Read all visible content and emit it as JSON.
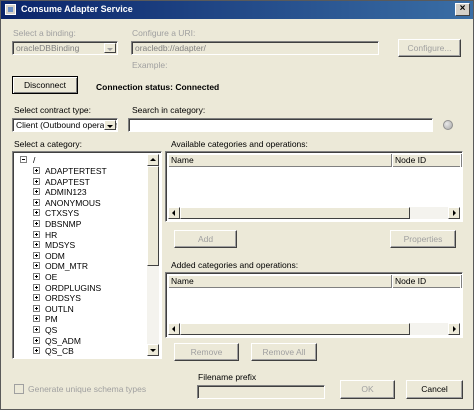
{
  "window": {
    "title": "Consume Adapter Service"
  },
  "binding": {
    "label": "Select a binding:",
    "value": "oracleDBBinding"
  },
  "uri": {
    "label": "Configure a URI:",
    "value": "oracledb://adapter/",
    "example_label": "Example:",
    "configure_button": "Configure..."
  },
  "connection": {
    "disconnect_button": "Disconnect",
    "status": "Connection status: Connected"
  },
  "contract": {
    "label": "Select contract type:",
    "value": "Client (Outbound operations)"
  },
  "search": {
    "label": "Search in category:",
    "value": ""
  },
  "category": {
    "label": "Select a category:",
    "root": "/",
    "items": [
      "ADAPTERTEST",
      "ADAPTEST",
      "ADMIN123",
      "ANONYMOUS",
      "CTXSYS",
      "DBSNMP",
      "HR",
      "MDSYS",
      "ODM",
      "ODM_MTR",
      "OE",
      "ORDPLUGINS",
      "ORDSYS",
      "OUTLN",
      "PM",
      "QS",
      "QS_ADM",
      "QS_CB"
    ]
  },
  "available": {
    "label": "Available categories and operations:",
    "columns": [
      "Name",
      "Node ID"
    ],
    "rows": []
  },
  "actions": {
    "add_button": "Add",
    "properties_button": "Properties",
    "remove_button": "Remove",
    "remove_all_button": "Remove All"
  },
  "added": {
    "label": "Added categories and operations:",
    "columns": [
      "Name",
      "Node ID"
    ],
    "rows": []
  },
  "footer": {
    "generate_label": "Generate unique schema types",
    "generate_checked": false,
    "filename_label": "Filename prefix",
    "filename_value": "",
    "ok_button": "OK",
    "cancel_button": "Cancel"
  }
}
